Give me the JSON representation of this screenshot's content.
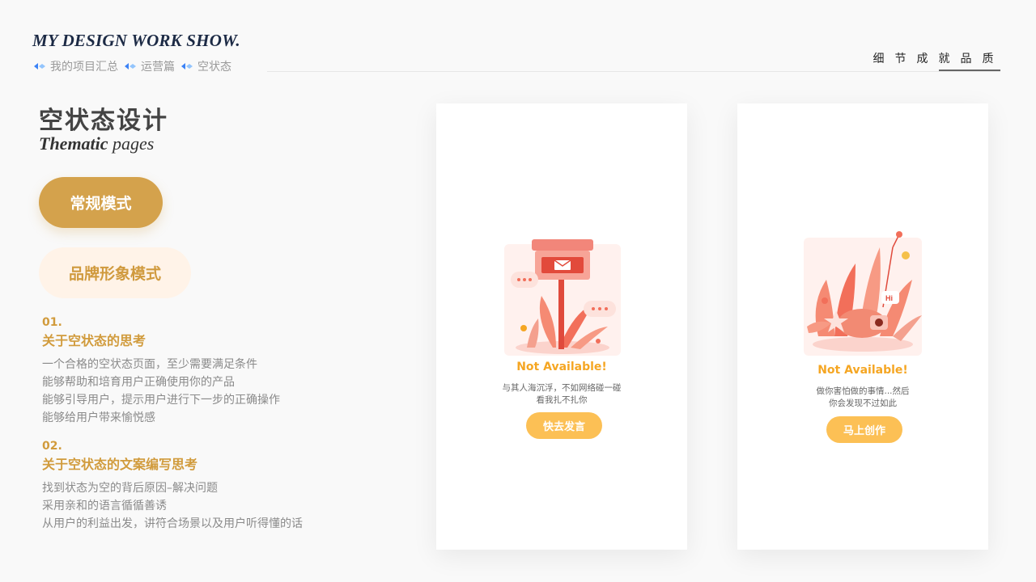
{
  "header": {
    "brand_title": "MY DESIGN WORK SHOW.",
    "breadcrumb": [
      {
        "label": "我的项目汇总",
        "icon": "diamond-arrow-icon"
      },
      {
        "label": "运营篇",
        "icon": "diamond-arrow-icon"
      },
      {
        "label": "空状态",
        "icon": "diamond-arrow-icon"
      }
    ],
    "slogan": [
      "细",
      "节",
      "成",
      "就",
      "品",
      "质"
    ]
  },
  "intro": {
    "title": "空状态设计",
    "subtitle_bold": "Thematic",
    "subtitle_thin": "pages"
  },
  "modes": {
    "normal_label": "常规模式",
    "brand_label": "品牌形象模式"
  },
  "sections": [
    {
      "num": "01.",
      "title": "关于空状态的思考",
      "lines": [
        "一个合格的空状态页面，至少需要满足条件",
        "能够帮助和培育用户正确使用你的产品",
        "能够引导用户，提示用户进行下一步的正确操作",
        "能够给用户带来愉悦感"
      ]
    },
    {
      "num": "02.",
      "title": "关于空状态的文案编写思考",
      "lines": [
        "找到状态为空的背后原因–解决问题",
        "采用亲和的语言循循善诱",
        "从用户的利益出发，讲符合场景以及用户听得懂的话"
      ]
    }
  ],
  "cards": [
    {
      "illustration": "mailbox-illustration",
      "heading": "Not Available!",
      "line1": "与其人海沉浮，不如网络碰一碰",
      "line2": "看我扎不扎你",
      "button": "快去发言"
    },
    {
      "illustration": "plants-illustration",
      "heading": "Not Available!",
      "line1": "做你害怕做的事情...然后",
      "line2": "你会发现不过如此",
      "button": "马上创作"
    }
  ],
  "colors": {
    "accent": "#d4a24c",
    "accent_light": "#fff3e8",
    "button_yellow": "#fcc055",
    "heading_orange": "#f5a623",
    "navy": "#1c2a45"
  }
}
